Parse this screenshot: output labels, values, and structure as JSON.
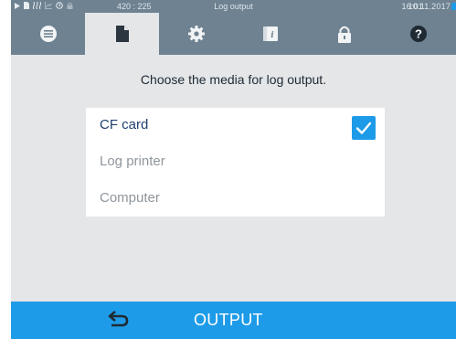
{
  "status_bar": {
    "coords": "420 : 225",
    "title": "Log output",
    "time": "16:01",
    "date": "10.11.2017",
    "icons": [
      "play-icon",
      "document-icon",
      "steam-icon",
      "chart-icon",
      "timer-icon",
      "lock-icon"
    ]
  },
  "tabs": [
    {
      "name": "list-icon",
      "active": false
    },
    {
      "name": "document-icon",
      "active": true
    },
    {
      "name": "gear-icon",
      "active": false
    },
    {
      "name": "info-book-icon",
      "active": false
    },
    {
      "name": "lock-icon",
      "active": false
    },
    {
      "name": "help-icon",
      "active": false
    }
  ],
  "prompt": "Choose the media for log output.",
  "options": [
    {
      "label": "CF card",
      "selected": true
    },
    {
      "label": "Log printer",
      "selected": false
    },
    {
      "label": "Computer",
      "selected": false
    }
  ],
  "footer": {
    "back_icon": "return-arrow-icon",
    "output_label": "OUTPUT"
  },
  "colors": {
    "accent": "#1e9be8",
    "header": "#6e8291",
    "background": "#e4e6e8",
    "tab_icon": "#f2f4f5",
    "active_tab_icon": "#2b3640"
  }
}
